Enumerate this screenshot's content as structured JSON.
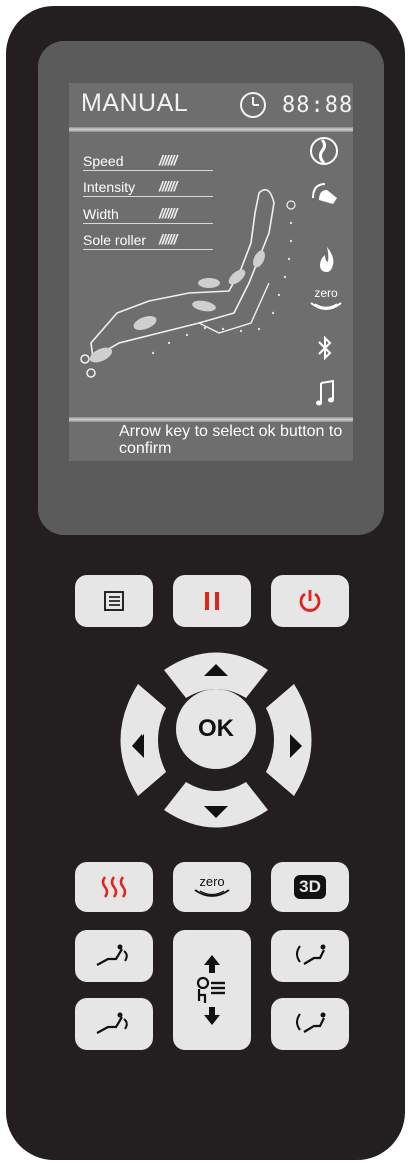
{
  "lcd": {
    "title": "MANUAL",
    "time": "88:88",
    "params": [
      {
        "label": "Speed",
        "bars": "//////"
      },
      {
        "label": "Intensity",
        "bars": "//////"
      },
      {
        "label": "Width",
        "bars": "//////"
      },
      {
        "label": "Sole roller",
        "bars": "//////"
      }
    ],
    "message": "Arrow key to select ok button to confirm",
    "icons": [
      "spine-icon",
      "hand-massage-icon",
      "flame-icon",
      "zero-gravity-icon",
      "bluetooth-icon",
      "music-icon"
    ],
    "zero_label": "zero"
  },
  "buttons": {
    "menu": "menu-icon",
    "pause": "pause-icon",
    "power": "power-icon",
    "ok_label": "OK",
    "heat": "heat-icon",
    "zero_label": "zero",
    "three_d_label": "3D",
    "recline_back": "recline-back-icon",
    "recline_leg": "recline-leg-icon",
    "body_adjust": "body-position-icon"
  },
  "colors": {
    "body": "#231f20",
    "accent_red": "#e2231a",
    "button": "#e6e6e6"
  }
}
